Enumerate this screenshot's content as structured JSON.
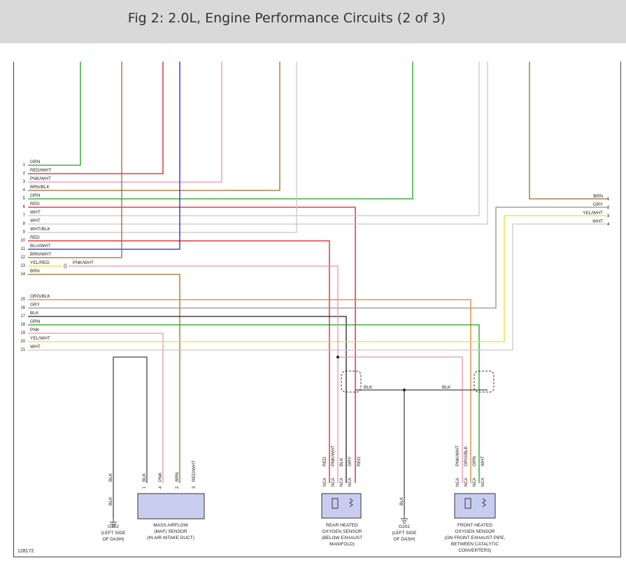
{
  "title": "Fig 2: 2.0L, Engine Performance Circuits (2 of 3)",
  "figure_id": "128172",
  "colors": {
    "GRN": "#1aa01a",
    "RED": "#e01818",
    "PNK": "#f090b0",
    "BRN": "#9a6a2a",
    "BLU": "#2020d0",
    "WHT": "#c8c8c8",
    "YEL": "#f0e020",
    "ORG": "#e08020",
    "GRY": "#909090",
    "BLK": "#202020"
  },
  "left_connector": {
    "pins": [
      {
        "num": "1",
        "wire": "GRN"
      },
      {
        "num": "2",
        "wire": "RED/WHT"
      },
      {
        "num": "3",
        "wire": "PNK/WHT"
      },
      {
        "num": "4",
        "wire": "BRN/BLK"
      },
      {
        "num": "5",
        "wire": "GRN"
      },
      {
        "num": "6",
        "wire": "RED"
      },
      {
        "num": "7",
        "wire": "WHT"
      },
      {
        "num": "8",
        "wire": "WHT"
      },
      {
        "num": "9",
        "wire": "WHT/BLK"
      },
      {
        "num": "10",
        "wire": "RED"
      },
      {
        "num": "11",
        "wire": "BLU/WHT"
      },
      {
        "num": "12",
        "wire": "BRN/WHT"
      },
      {
        "num": "13",
        "wire": "YEL/RED"
      },
      {
        "num": "14",
        "wire": "BRN"
      },
      {
        "num": "15",
        "wire": "ORG/BLK"
      },
      {
        "num": "16",
        "wire": "GRY"
      },
      {
        "num": "17",
        "wire": "BLK"
      },
      {
        "num": "18",
        "wire": "GRN"
      },
      {
        "num": "19",
        "wire": "PNK"
      },
      {
        "num": "20",
        "wire": "YEL/WHT"
      },
      {
        "num": "21",
        "wire": "WHT"
      }
    ],
    "splice_label": "PNK/WHT"
  },
  "right_connector": {
    "pins": [
      {
        "num": "1",
        "wire": "BRN"
      },
      {
        "num": "2",
        "wire": "GRY"
      },
      {
        "num": "3",
        "wire": "YEL/WHT"
      },
      {
        "num": "4",
        "wire": "WHT"
      }
    ]
  },
  "ground_bus": {
    "left_label": "BLK",
    "right_label": "BLK"
  },
  "components": {
    "maf": {
      "name": [
        "MASS AIRFLOW",
        "(MAF) SENSOR",
        "(IN AIR INTAKE DUCT)"
      ],
      "pins": [
        {
          "num": "1",
          "wire": "BLK"
        },
        {
          "num": "4",
          "wire": "PNK"
        },
        {
          "num": "2",
          "wire": "BRN"
        },
        {
          "num": "3",
          "wire": "RED/WHT"
        }
      ]
    },
    "g202_left": {
      "name": [
        "G202",
        "(LEFT SIDE",
        "OF DASH)"
      ],
      "wire_top": "BLK",
      "wire_bottom": "BLK"
    },
    "rear_o2": {
      "name": [
        "REAR HEATED",
        "OXYGEN SENSOR",
        "(BELOW EXHAUST",
        "MANIFOLD)"
      ],
      "pins": [
        {
          "num": "4",
          "wire": "RED"
        },
        {
          "num": "3",
          "wire": "PNK/WHT"
        },
        {
          "num": "5",
          "wire": "BLK"
        },
        {
          "num": "2",
          "wire": "GRY"
        },
        {
          "num": "1",
          "wire": "RED"
        }
      ],
      "nca": [
        "NCA",
        "NCA",
        "NCA",
        "NCA",
        "NCA"
      ]
    },
    "g202_mid": {
      "name": [
        "G202",
        "(LEFT SIDE",
        "OF DASH)"
      ],
      "wire": "BLK"
    },
    "front_o2": {
      "name": [
        "FRONT HEATED",
        "OXYGEN SENSOR",
        "(ON FRONT EXHAUST PIPE,",
        "BETWEEN CATALYTIC",
        "CONVERTERS)"
      ],
      "pins": [
        {
          "num": "4",
          "wire": "PNK/WHT"
        },
        {
          "num": "3",
          "wire": "ORG/BLK"
        },
        {
          "num": "2",
          "wire": "GRN"
        },
        {
          "num": "1",
          "wire": "WHT"
        }
      ],
      "nca": [
        "NCA",
        "NCA",
        "NCA",
        "NCA"
      ]
    }
  }
}
